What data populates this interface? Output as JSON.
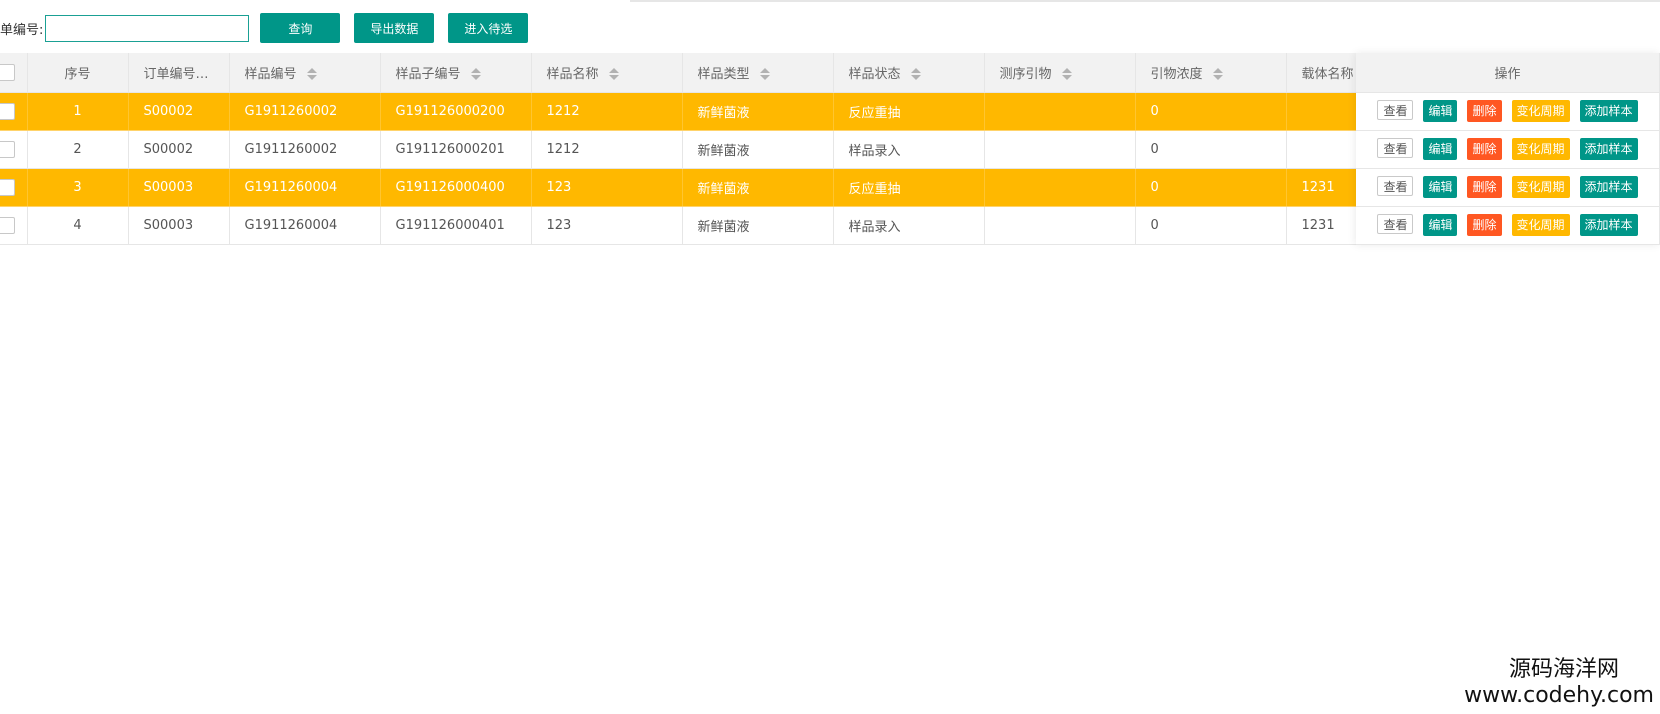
{
  "search": {
    "label": "单编号:",
    "value": "",
    "placeholder": ""
  },
  "toolbar": {
    "query_label": "查询",
    "export_label": "导出数据",
    "pending_label": "进入待选"
  },
  "table": {
    "headers": {
      "index": "序号",
      "order_no": "订单编号…",
      "sample_no": "样品编号",
      "sub_no": "样品子编号",
      "name": "样品名称",
      "type": "样品类型",
      "status": "样品状态",
      "primer": "测序引物",
      "concentration": "引物浓度",
      "carrier": "载体名称",
      "actions": "操作"
    },
    "rows": [
      {
        "highlight": true,
        "index": "1",
        "order_no": "S00002",
        "sample_no": "G1911260002",
        "sub_no": "G191126000200",
        "name": "1212",
        "type": "新鲜菌液",
        "status": "反应重抽",
        "primer": "",
        "concentration": "0",
        "carrier": ""
      },
      {
        "highlight": false,
        "index": "2",
        "order_no": "S00002",
        "sample_no": "G1911260002",
        "sub_no": "G191126000201",
        "name": "1212",
        "type": "新鲜菌液",
        "status": "样品录入",
        "primer": "",
        "concentration": "0",
        "carrier": ""
      },
      {
        "highlight": true,
        "index": "3",
        "order_no": "S00003",
        "sample_no": "G1911260004",
        "sub_no": "G191126000400",
        "name": "123",
        "type": "新鲜菌液",
        "status": "反应重抽",
        "primer": "",
        "concentration": "0",
        "carrier": "1231"
      },
      {
        "highlight": false,
        "index": "4",
        "order_no": "S00003",
        "sample_no": "G1911260004",
        "sub_no": "G191126000401",
        "name": "123",
        "type": "新鲜菌液",
        "status": "样品录入",
        "primer": "",
        "concentration": "0",
        "carrier": "1231"
      }
    ],
    "actions": {
      "view": "查看",
      "edit": "编辑",
      "delete": "删除",
      "change_cycle": "变化周期",
      "add_sample": "添加样本"
    }
  },
  "watermark": {
    "line1": "源码海洋网",
    "line2": "www.codehy.com"
  },
  "colors": {
    "primary": "#009688",
    "highlight": "#FFB800",
    "danger": "#FF5722"
  }
}
